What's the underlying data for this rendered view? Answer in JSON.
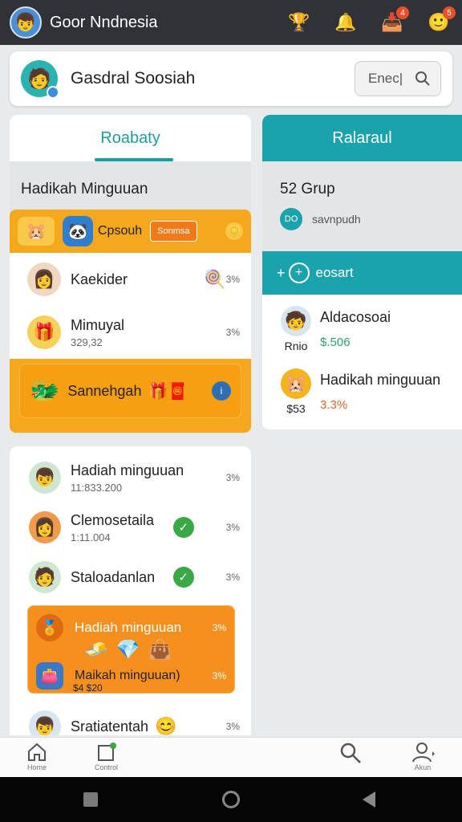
{
  "app": {
    "title": "Goor Nndnesia"
  },
  "topbar_icons": [
    {
      "name": "trophy-icon",
      "glyph": "🏆"
    },
    {
      "name": "bell-icon",
      "glyph": "🔔"
    },
    {
      "name": "inbox-icon",
      "glyph": "📥",
      "badge": "4"
    },
    {
      "name": "profile-icon",
      "glyph": "🙂",
      "badge": "5"
    }
  ],
  "header": {
    "title": "Gasdral Soosiah",
    "search_label": "Enec|"
  },
  "tabs": {
    "left": "Roabaty",
    "right": "Ralaraul"
  },
  "left": {
    "section_title": "Hadikah Minguuan",
    "orange_card": {
      "label": "Cpsouh",
      "tag": "Sonmsa",
      "items": [
        {
          "name": "Kaekider",
          "sub": "",
          "pct": "3%"
        },
        {
          "name": "Mimuyal",
          "sub": "329,32",
          "pct": "3%"
        }
      ],
      "footer_label": "Sannehgah"
    }
  },
  "right": {
    "group_count": "52 Grup",
    "group_text": "savnpudh",
    "group_badge": "DO",
    "card_header": "eosart",
    "rows": [
      {
        "avatar_label": "Rnio",
        "title": "Aldacosoai",
        "value": "$.506",
        "value_color": "#2aa26a"
      },
      {
        "avatar_label": "$53",
        "title": "Hadikah minguuan",
        "value": "3.3%",
        "value_color": "#e0652b"
      }
    ]
  },
  "bottom_list": {
    "rows": [
      {
        "name": "Hadiah minguuan",
        "sub": "11:833.200",
        "pct": "3%"
      },
      {
        "name": "Clemosetaila",
        "sub": "1:11.004",
        "pct": "3%"
      },
      {
        "name": "Staloadanlan",
        "sub": "",
        "pct": "3%"
      }
    ],
    "promo": {
      "title": "Hadiah minguuan",
      "title_pct": "3%",
      "sub_title": "Maikah minguuan)",
      "sub_pct": "3%",
      "sub_value": "$4 $20"
    },
    "last_row": {
      "name": "Sratiatentah",
      "pct": "3%"
    }
  },
  "bottom_nav": [
    {
      "name": "home",
      "label": "Home"
    },
    {
      "name": "control",
      "label": "Control"
    },
    {
      "name": "search",
      "label": ""
    },
    {
      "name": "profile",
      "label": "Akun"
    }
  ]
}
